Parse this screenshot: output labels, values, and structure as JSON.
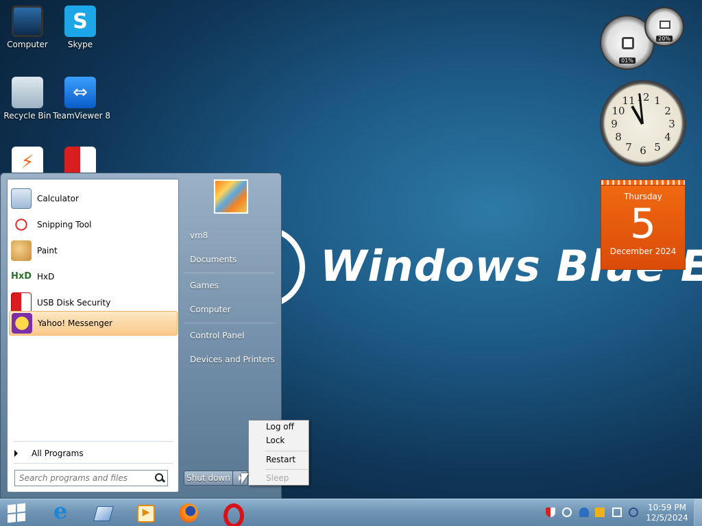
{
  "desktop": {
    "icons": [
      {
        "label": "Computer",
        "icon": "computer-icon"
      },
      {
        "label": "Skype",
        "icon": "skype-icon"
      },
      {
        "label": "Recycle Bin",
        "icon": "recycle-bin-icon"
      },
      {
        "label": "TeamViewer 8",
        "icon": "teamviewer-icon"
      },
      {
        "label": "",
        "icon": "lightning-app-icon"
      },
      {
        "label": "",
        "icon": "shield-app-icon"
      }
    ],
    "wallpaper_text": "Windows Blue Edition"
  },
  "gadgets": {
    "cpu_meter": {
      "cpu": "01%",
      "memory": "20%"
    },
    "clock": {
      "numbers": [
        "12",
        "1",
        "2",
        "3",
        "4",
        "5",
        "6",
        "7",
        "8",
        "9",
        "10",
        "11"
      ],
      "time": "10:59"
    },
    "calendar": {
      "weekday": "Thursday",
      "day": "5",
      "month_year": "December 2024"
    }
  },
  "start_menu": {
    "programs": [
      {
        "label": "Calculator",
        "icon": "calculator-icon"
      },
      {
        "label": "Snipping Tool",
        "icon": "snipping-tool-icon"
      },
      {
        "label": "Paint",
        "icon": "paint-icon"
      },
      {
        "label": "HxD",
        "icon": "hxd-icon"
      },
      {
        "label": "USB Disk Security",
        "icon": "usb-disk-security-icon"
      },
      {
        "label": "Yahoo! Messenger",
        "icon": "yahoo-messenger-icon",
        "selected": true
      }
    ],
    "all_programs": "All Programs",
    "search_placeholder": "Search programs and files",
    "right_items": [
      "vm8",
      "Documents",
      "Games",
      "Computer",
      "Control Panel",
      "Devices and Printers"
    ],
    "shutdown_label": "Shut down",
    "shutdown_submenu": [
      {
        "label": "Log off",
        "enabled": true
      },
      {
        "label": "Lock",
        "enabled": true
      },
      {
        "label": "Restart",
        "enabled": true
      },
      {
        "label": "Sleep",
        "enabled": false
      }
    ]
  },
  "taskbar": {
    "pinned": [
      "start-button",
      "internet-explorer-icon",
      "box-app-icon",
      "media-player-icon",
      "firefox-icon",
      "opera-icon"
    ],
    "tray_icons": [
      "shield-tray-icon",
      "chat-tray-icon",
      "cloud-tray-icon",
      "home-tray-icon",
      "network-tray-icon",
      "teamviewer-tray-icon"
    ],
    "time": "10:59 PM",
    "date": "12/5/2024"
  }
}
